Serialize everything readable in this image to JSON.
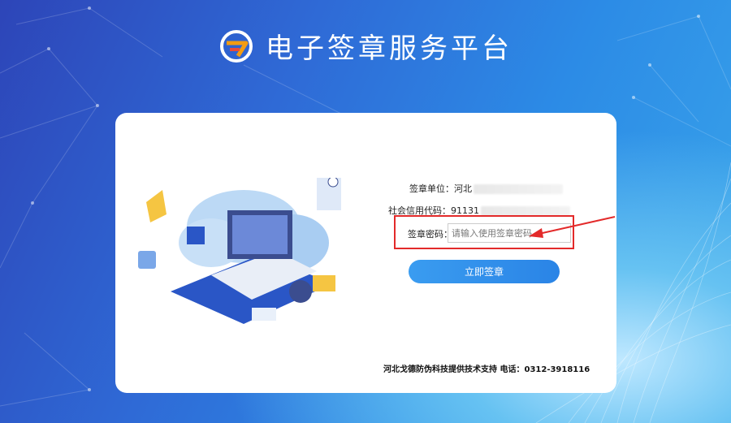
{
  "header": {
    "title": "电子签章服务平台"
  },
  "form": {
    "unit_label": "签章单位：",
    "unit_value": "河北",
    "credit_label": "社会信用代码：",
    "credit_value": "91131",
    "password_label": "签章密码：",
    "password_placeholder": "请输入使用签章密码",
    "submit_label": "立即签章"
  },
  "footer": {
    "support_text": "河北戈德防伪科技提供技术支持",
    "phone_label": "电话：",
    "phone": "0312-3918116"
  },
  "colors": {
    "accent": "#2a84e6",
    "highlight": "#e32a2a"
  }
}
